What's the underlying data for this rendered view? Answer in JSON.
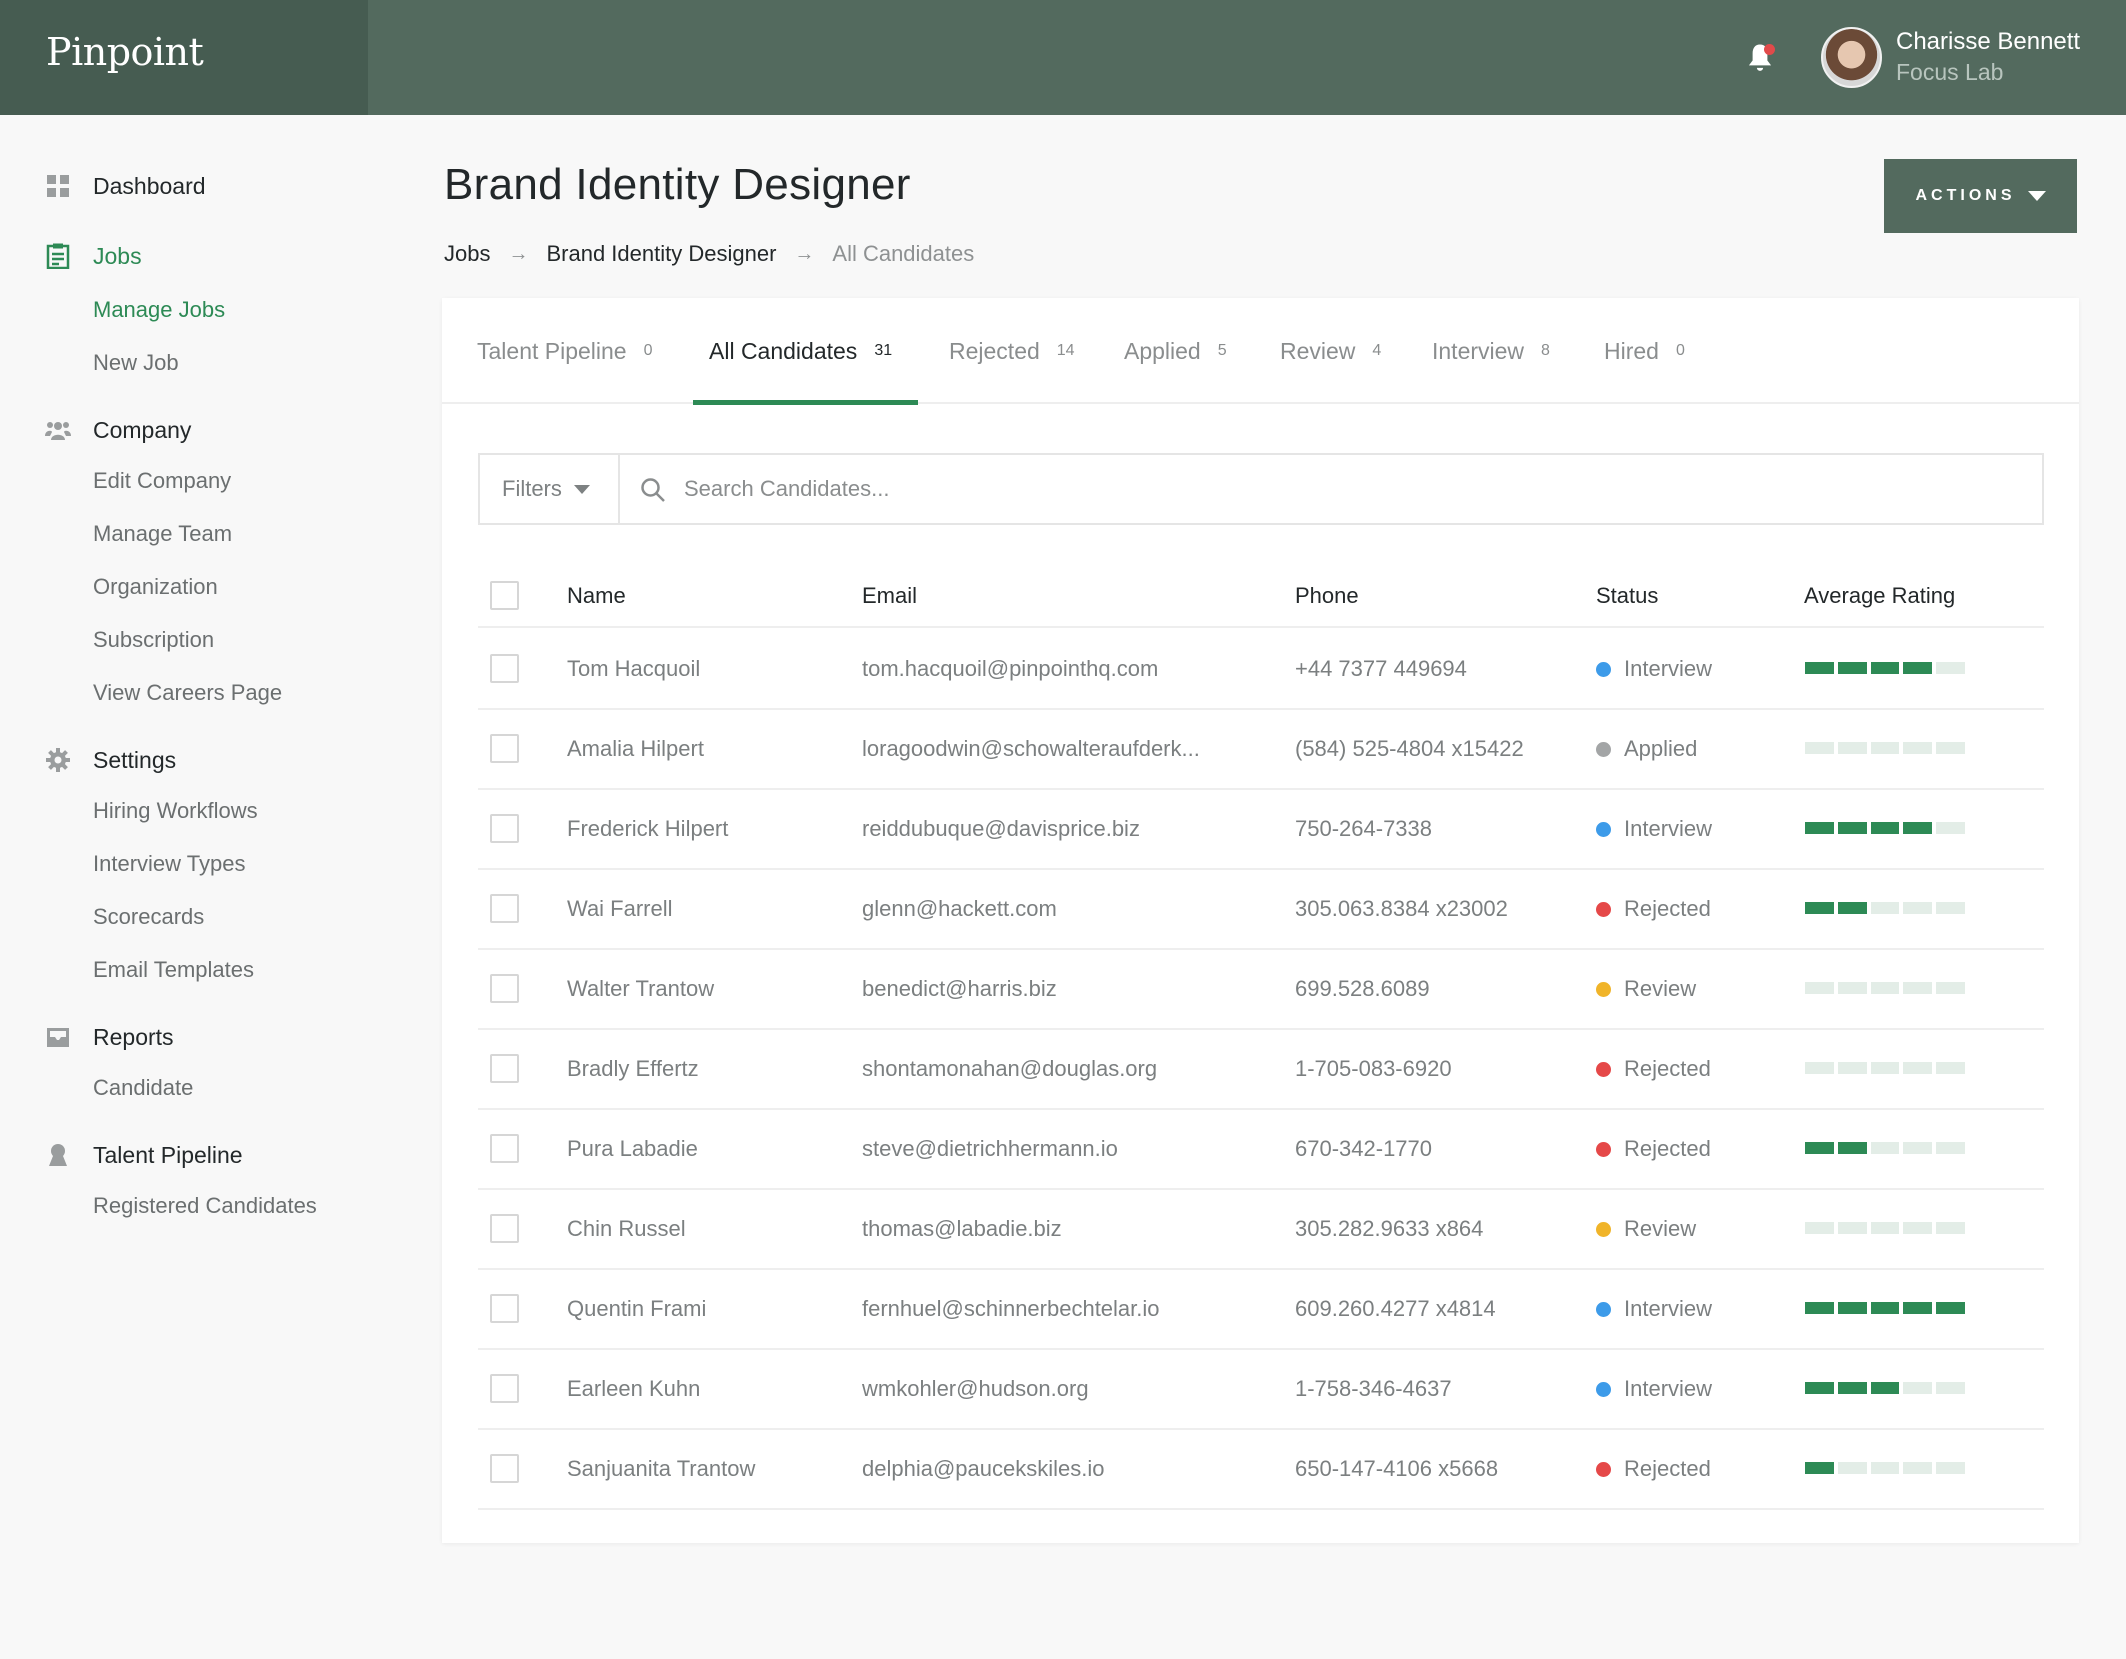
{
  "app": {
    "brand": "Pinpoint"
  },
  "user": {
    "name": "Charisse Bennett",
    "org": "Focus Lab"
  },
  "sidebar": {
    "dashboard": "Dashboard",
    "jobs": "Jobs",
    "manage_jobs": "Manage Jobs",
    "new_job": "New Job",
    "company": "Company",
    "edit_company": "Edit Company",
    "manage_team": "Manage Team",
    "organization": "Organization",
    "subscription": "Subscription",
    "view_careers": "View Careers Page",
    "settings": "Settings",
    "hiring_workflows": "Hiring Workflows",
    "interview_types": "Interview Types",
    "scorecards": "Scorecards",
    "email_templates": "Email Templates",
    "reports": "Reports",
    "candidate": "Candidate",
    "talent_pipeline": "Talent Pipeline",
    "registered_candidates": "Registered Candidates"
  },
  "page": {
    "title": "Brand Identity Designer",
    "breadcrumb": [
      "Jobs",
      "Brand Identity Designer",
      "All Candidates"
    ],
    "actions_label": "ACTIONS"
  },
  "tabs": [
    {
      "label": "Talent Pipeline",
      "count": "0"
    },
    {
      "label": "All Candidates",
      "count": "31"
    },
    {
      "label": "Rejected",
      "count": "14"
    },
    {
      "label": "Applied",
      "count": "5"
    },
    {
      "label": "Review",
      "count": "4"
    },
    {
      "label": "Interview",
      "count": "8"
    },
    {
      "label": "Hired",
      "count": "0"
    }
  ],
  "search": {
    "filters_label": "Filters",
    "placeholder": "Search Candidates..."
  },
  "table": {
    "headers": {
      "name": "Name",
      "email": "Email",
      "phone": "Phone",
      "status": "Status",
      "rating": "Average Rating"
    },
    "rows": [
      {
        "name": "Tom Hacquoil",
        "email": "tom.hacquoil@pinpointhq.com",
        "phone": "+44 7377 449694",
        "status": "Interview",
        "rating": 4
      },
      {
        "name": "Amalia Hilpert",
        "email": "loragoodwin@schowalteraufderk...",
        "phone": "(584) 525-4804 x15422",
        "status": "Applied",
        "rating": 0
      },
      {
        "name": "Frederick Hilpert",
        "email": "reiddubuque@davisprice.biz",
        "phone": "750-264-7338",
        "status": "Interview",
        "rating": 4
      },
      {
        "name": "Wai Farrell",
        "email": "glenn@hackett.com",
        "phone": "305.063.8384 x23002",
        "status": "Rejected",
        "rating": 2
      },
      {
        "name": "Walter Trantow",
        "email": "benedict@harris.biz",
        "phone": "699.528.6089",
        "status": "Review",
        "rating": 0
      },
      {
        "name": "Bradly Effertz",
        "email": "shontamonahan@douglas.org",
        "phone": "1-705-083-6920",
        "status": "Rejected",
        "rating": 0
      },
      {
        "name": "Pura Labadie",
        "email": "steve@dietrichhermann.io",
        "phone": "670-342-1770",
        "status": "Rejected",
        "rating": 2
      },
      {
        "name": "Chin Russel",
        "email": "thomas@labadie.biz",
        "phone": "305.282.9633 x864",
        "status": "Review",
        "rating": 0
      },
      {
        "name": "Quentin Frami",
        "email": "fernhuel@schinnerbechtelar.io",
        "phone": "609.260.4277 x4814",
        "status": "Interview",
        "rating": 5
      },
      {
        "name": "Earleen Kuhn",
        "email": "wmkohler@hudson.org",
        "phone": "1-758-346-4637",
        "status": "Interview",
        "rating": 3
      },
      {
        "name": "Sanjuanita Trantow",
        "email": "delphia@paucekskiles.io",
        "phone": "650-147-4106 x5668",
        "status": "Rejected",
        "rating": 1
      }
    ],
    "rating_max": 5
  },
  "colors": {
    "accent": "#2d8a55",
    "header": "#536a5e",
    "status_interview": "#3d9be9",
    "status_applied": "#a3a5a6",
    "status_rejected": "#e54848",
    "status_review": "#f0b429"
  }
}
